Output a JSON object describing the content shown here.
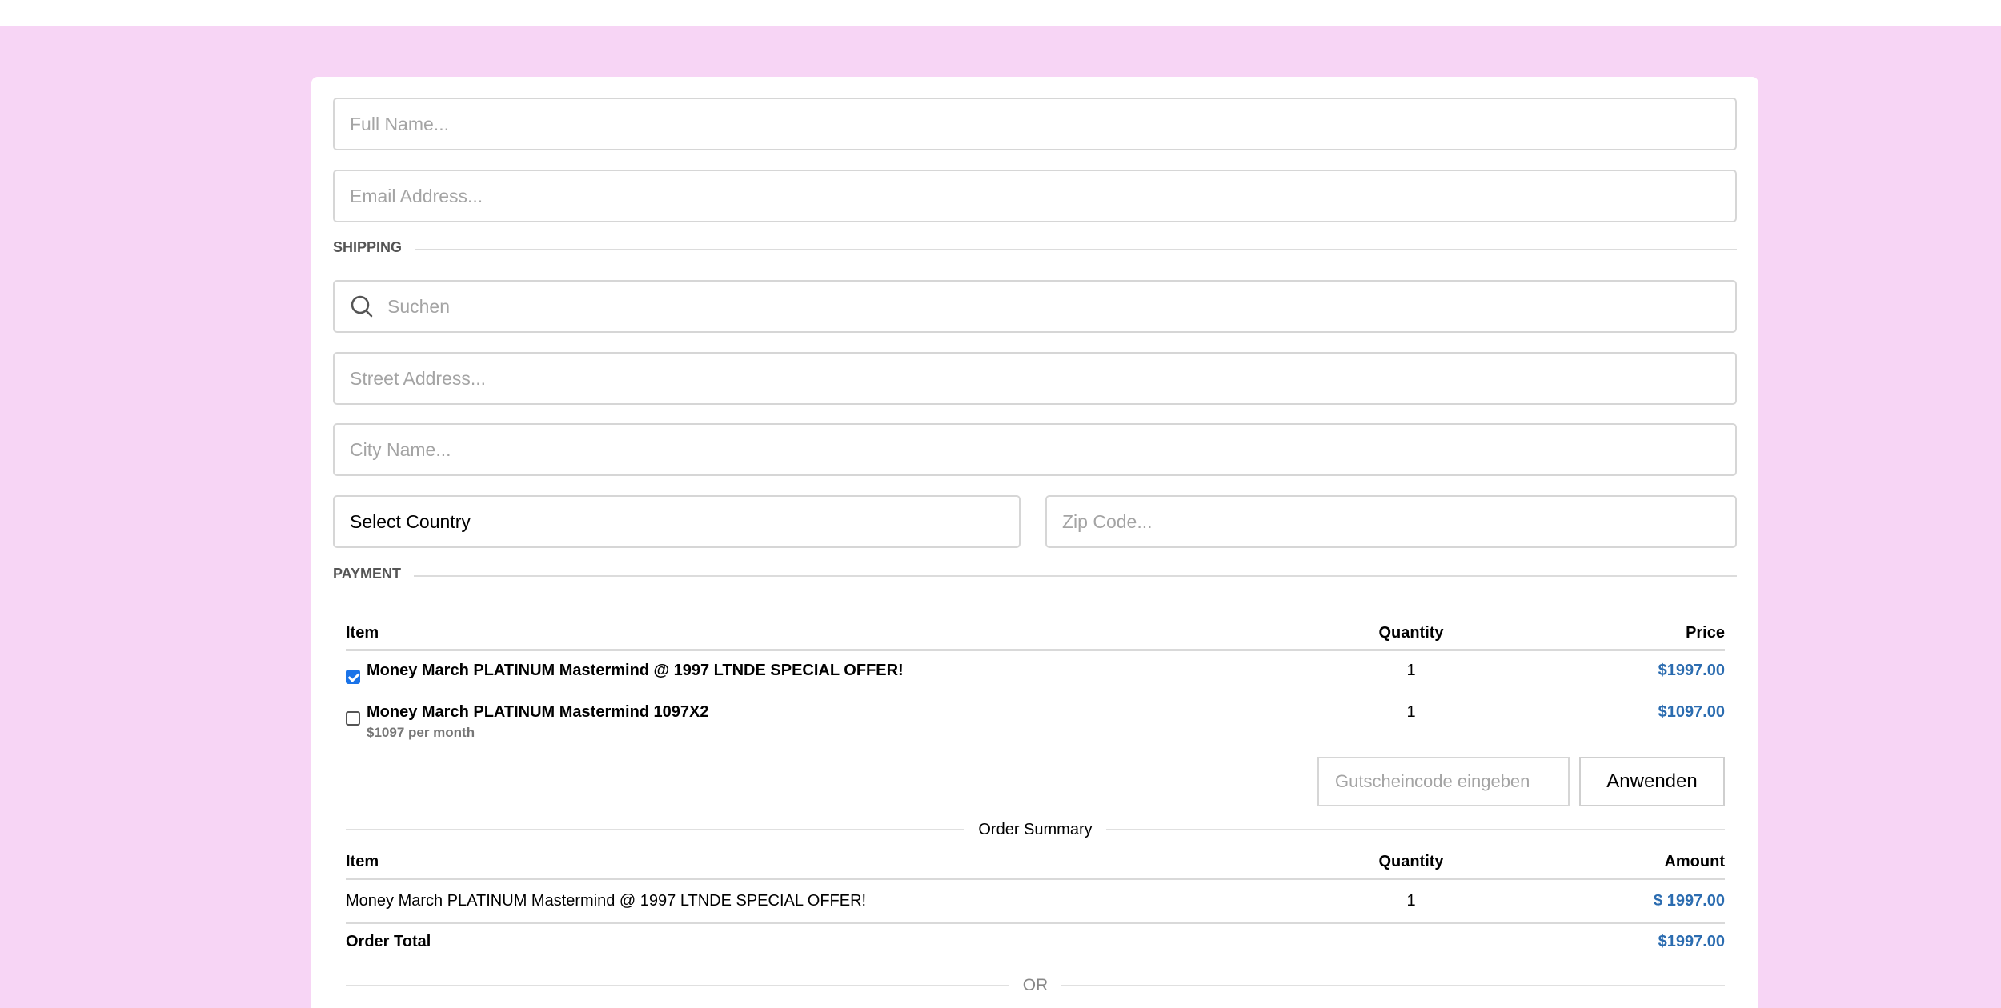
{
  "form": {
    "full_name_placeholder": "Full Name...",
    "email_placeholder": "Email Address..."
  },
  "shipping": {
    "label": "SHIPPING",
    "search_placeholder": "Suchen",
    "street_placeholder": "Street Address...",
    "city_placeholder": "City Name...",
    "country_value": "Select Country",
    "zip_placeholder": "Zip Code..."
  },
  "payment": {
    "label": "PAYMENT",
    "headers": {
      "item": "Item",
      "quantity": "Quantity",
      "price": "Price"
    },
    "items": [
      {
        "title": "Money March PLATINUM Mastermind @ 1997 LTNDE SPECIAL OFFER!",
        "subtitle": "",
        "quantity": "1",
        "price": "$1997.00",
        "checked": true
      },
      {
        "title": "Money March PLATINUM Mastermind 1097X2",
        "subtitle": "$1097 per month",
        "quantity": "1",
        "price": "$1097.00",
        "checked": false
      }
    ],
    "coupon_placeholder": "Gutscheincode eingeben",
    "apply_label": "Anwenden"
  },
  "summary": {
    "title": "Order Summary",
    "headers": {
      "item": "Item",
      "quantity": "Quantity",
      "amount": "Amount"
    },
    "rows": [
      {
        "item": "Money March PLATINUM Mastermind @ 1997 LTNDE SPECIAL OFFER!",
        "quantity": "1",
        "amount": "$ 1997.00"
      }
    ],
    "total_label": "Order Total",
    "total_amount": "$1997.00",
    "or_label": "OR"
  },
  "colors": {
    "background": "#f7d5f5",
    "price_blue": "#2b6cb0",
    "checkbox_blue": "#1a73e8"
  }
}
